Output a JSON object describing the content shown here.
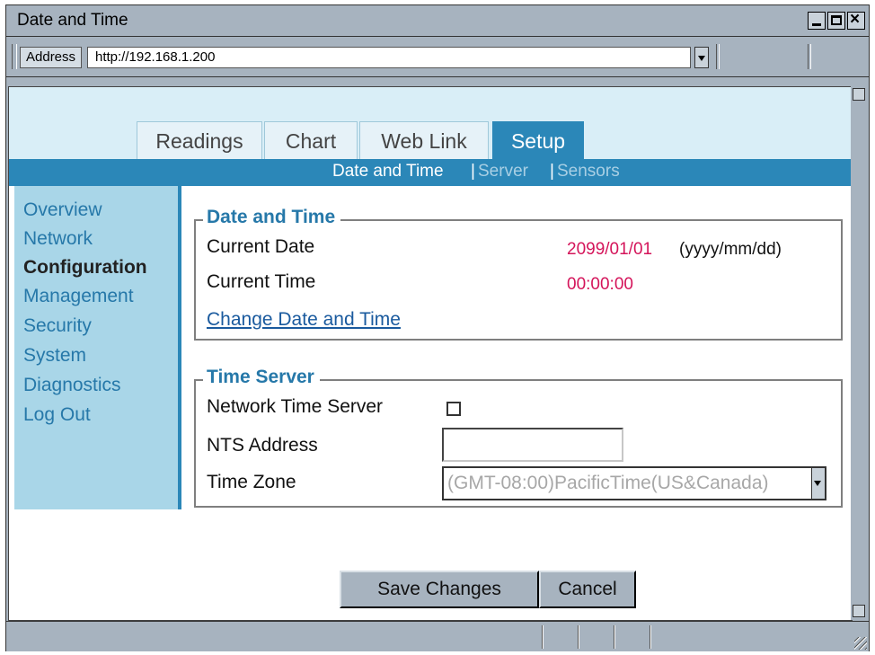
{
  "window": {
    "title": "Date and Time"
  },
  "address_bar": {
    "label": "Address",
    "url": "http://192.168.1.200"
  },
  "tabs": [
    {
      "label": "Readings",
      "active": false
    },
    {
      "label": "Chart",
      "active": false
    },
    {
      "label": "Web Link",
      "active": false
    },
    {
      "label": "Setup",
      "active": true
    }
  ],
  "subnav": {
    "current": "Date and Time",
    "separator": "|",
    "items": [
      "Server",
      "Sensors"
    ]
  },
  "sidebar": {
    "items": [
      "Overview",
      "Network",
      "Configuration",
      "Management",
      "Security",
      "System",
      "Diagnostics",
      "Log Out"
    ],
    "selected": "Configuration"
  },
  "date_time": {
    "legend": "Date and Time",
    "current_date_label": "Current Date",
    "current_date_value": "2099/01/01",
    "date_format": "(yyyy/mm/dd)",
    "current_time_label": "Current Time",
    "current_time_value": "00:00:00",
    "change_link": "Change Date and Time"
  },
  "time_server": {
    "legend": "Time Server",
    "nts_label": "Network Time Server",
    "nts_checked": false,
    "nts_address_label": "NTS Address",
    "nts_address_value": "",
    "time_zone_label": "Time Zone",
    "time_zone_value": "(GMT-08:00)PacificTime(US&Canada)"
  },
  "buttons": {
    "save": "Save Changes",
    "cancel": "Cancel"
  },
  "colors": {
    "accent_blue": "#2b87b8",
    "sidebar_bg": "#a9d6e8",
    "header_bg": "#d9eef7",
    "value_red": "#d4145a",
    "chrome_gray": "#a7b3bf"
  }
}
